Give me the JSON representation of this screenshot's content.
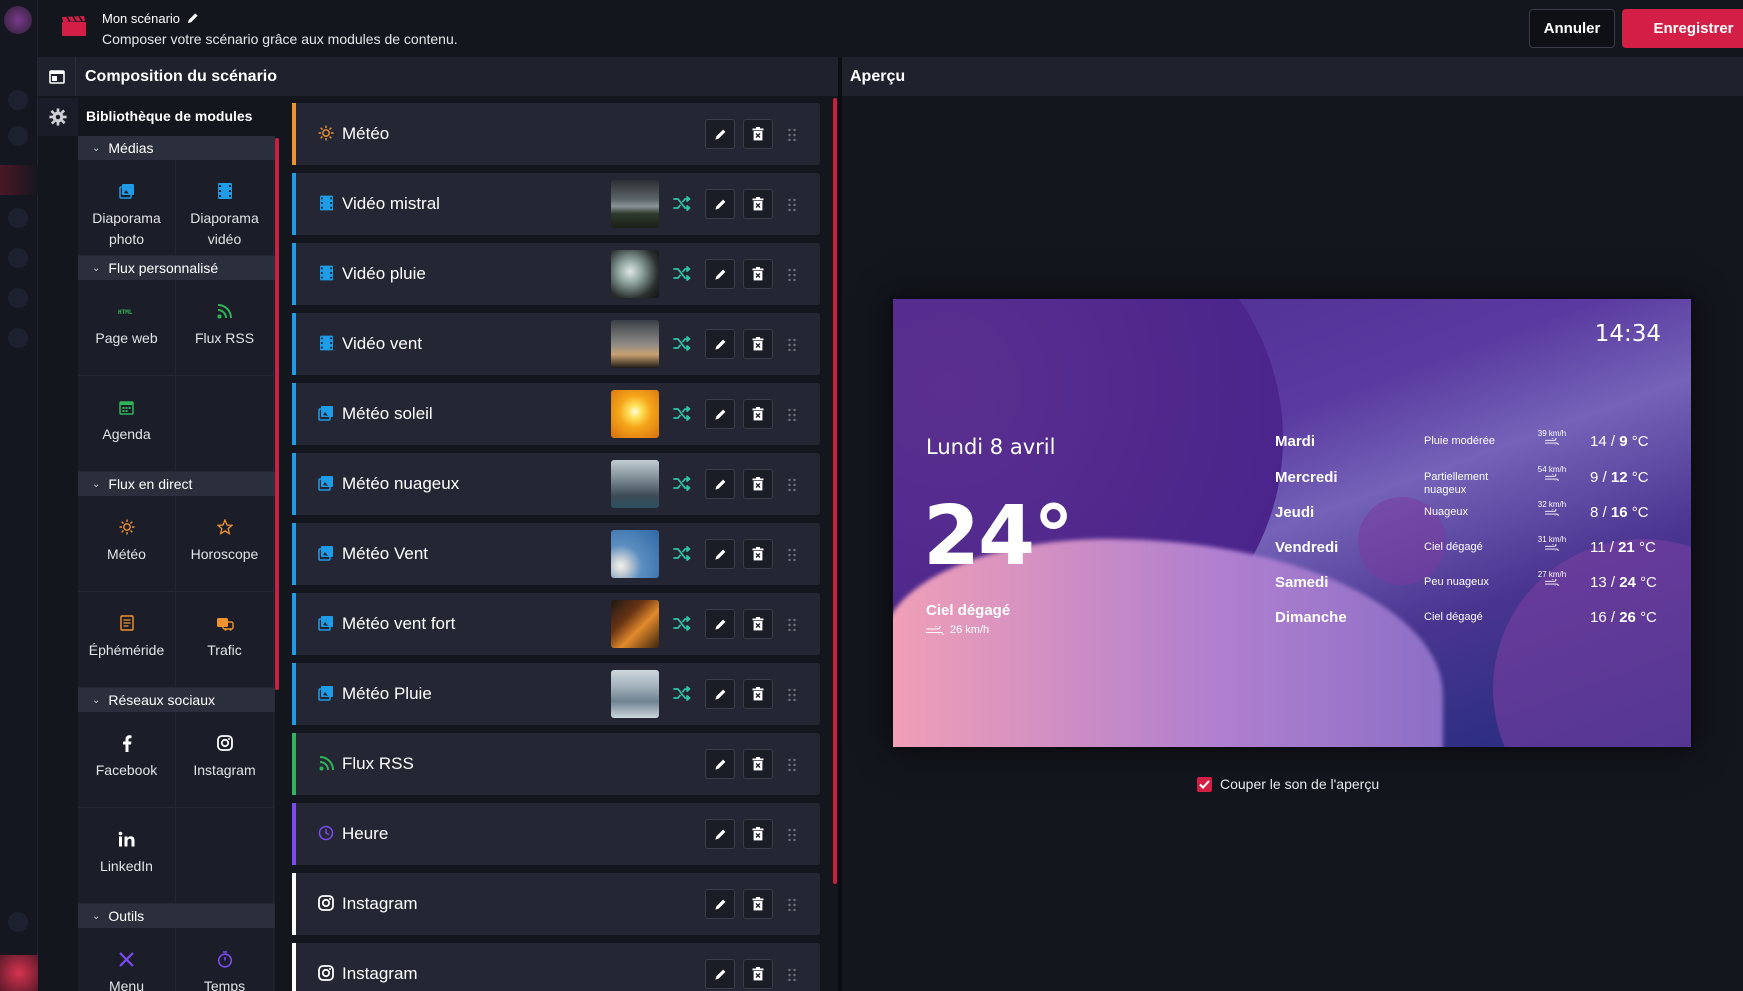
{
  "header": {
    "title": "Mon scénario",
    "subtitle": "Composer votre scénario grâce aux modules de contenu.",
    "cancel_label": "Annuler",
    "save_label": "Enregistrer"
  },
  "composition": {
    "title": "Composition du scénario"
  },
  "preview": {
    "title": "Aperçu",
    "mute_label": "Couper le son de l'aperçu",
    "mute_checked": true
  },
  "library": {
    "title": "Bibliothèque de modules",
    "categories": [
      {
        "name": "Médias",
        "tiles": [
          {
            "label": "Diaporama photo",
            "icon": "photo-slideshow-icon"
          },
          {
            "label": "Diaporama vidéo",
            "icon": "video-slideshow-icon"
          }
        ]
      },
      {
        "name": "Flux personnalisé",
        "tiles": [
          {
            "label": "Page web",
            "icon": "html-icon"
          },
          {
            "label": "Flux RSS",
            "icon": "rss-icon"
          },
          {
            "label": "Agenda",
            "icon": "calendar-icon"
          }
        ]
      },
      {
        "name": "Flux en direct",
        "tiles": [
          {
            "label": "Météo",
            "icon": "sun-icon"
          },
          {
            "label": "Horoscope",
            "icon": "star-icon"
          },
          {
            "label": "Éphéméride",
            "icon": "ephemeris-icon"
          },
          {
            "label": "Trafic",
            "icon": "traffic-icon"
          }
        ]
      },
      {
        "name": "Réseaux sociaux",
        "tiles": [
          {
            "label": "Facebook",
            "icon": "facebook-icon"
          },
          {
            "label": "Instagram",
            "icon": "instagram-icon"
          },
          {
            "label": "LinkedIn",
            "icon": "linkedin-icon"
          }
        ]
      },
      {
        "name": "Outils",
        "tiles": [
          {
            "label": "Menu",
            "icon": "menu-tool-icon"
          },
          {
            "label": "Temps",
            "icon": "timer-icon"
          }
        ]
      }
    ]
  },
  "scenario_items": [
    {
      "label": "Météo",
      "icon": "sun-icon",
      "color": "#f0922e",
      "thumb": null
    },
    {
      "label": "Vidéo mistral",
      "icon": "video-icon",
      "color": "#1f9ce8",
      "thumb": "storm"
    },
    {
      "label": "Vidéo pluie",
      "icon": "video-icon",
      "color": "#1f9ce8",
      "thumb": "rain"
    },
    {
      "label": "Vidéo vent",
      "icon": "video-icon",
      "color": "#1f9ce8",
      "thumb": "wind"
    },
    {
      "label": "Météo soleil",
      "icon": "image-icon",
      "color": "#1f9ce8",
      "thumb": "sun"
    },
    {
      "label": "Météo nuageux",
      "icon": "image-icon",
      "color": "#1f9ce8",
      "thumb": "clouds"
    },
    {
      "label": "Météo Vent",
      "icon": "image-icon",
      "color": "#1f9ce8",
      "thumb": "dandelion"
    },
    {
      "label": "Météo vent fort",
      "icon": "image-icon",
      "color": "#1f9ce8",
      "thumb": "sunset"
    },
    {
      "label": "Météo Pluie",
      "icon": "image-icon",
      "color": "#1f9ce8",
      "thumb": "city-rain"
    },
    {
      "label": "Flux RSS",
      "icon": "rss-icon",
      "color": "#2fb45a",
      "thumb": null
    },
    {
      "label": "Heure",
      "icon": "clock-icon",
      "color": "#7a4cf0",
      "thumb": null
    },
    {
      "label": "Instagram",
      "icon": "instagram-icon",
      "color": "#ffffff",
      "thumb": null
    },
    {
      "label": "Instagram",
      "icon": "instagram-icon",
      "color": "#ffffff",
      "thumb": null
    }
  ],
  "weather_preview": {
    "time": "14:34",
    "date": "Lundi 8 avril",
    "temp": "24°",
    "condition": "Ciel dégagé",
    "wind": "26 km/h",
    "forecast": [
      {
        "day": "Mardi",
        "cond": "Pluie modérée",
        "wind": "39 km/h",
        "min": "14",
        "max": "9",
        "unit": "°C"
      },
      {
        "day": "Mercredi",
        "cond": "Partiellement nuageux",
        "wind": "54 km/h",
        "min": "9",
        "max": "12",
        "unit": "°C"
      },
      {
        "day": "Jeudi",
        "cond": "Nuageux",
        "wind": "32 km/h",
        "min": "8",
        "max": "16",
        "unit": "°C"
      },
      {
        "day": "Vendredi",
        "cond": "Ciel dégagé",
        "wind": "31 km/h",
        "min": "11",
        "max": "21",
        "unit": "°C"
      },
      {
        "day": "Samedi",
        "cond": "Peu nuageux",
        "wind": "27 km/h",
        "min": "13",
        "max": "24",
        "unit": "°C"
      },
      {
        "day": "Dimanche",
        "cond": "Ciel dégagé",
        "wind": "",
        "min": "16",
        "max": "26",
        "unit": "°C"
      }
    ]
  },
  "colors": {
    "accent": "#d31f45",
    "teal": "#2ec4a8",
    "blue": "#1f9ce8",
    "orange": "#f0922e"
  }
}
